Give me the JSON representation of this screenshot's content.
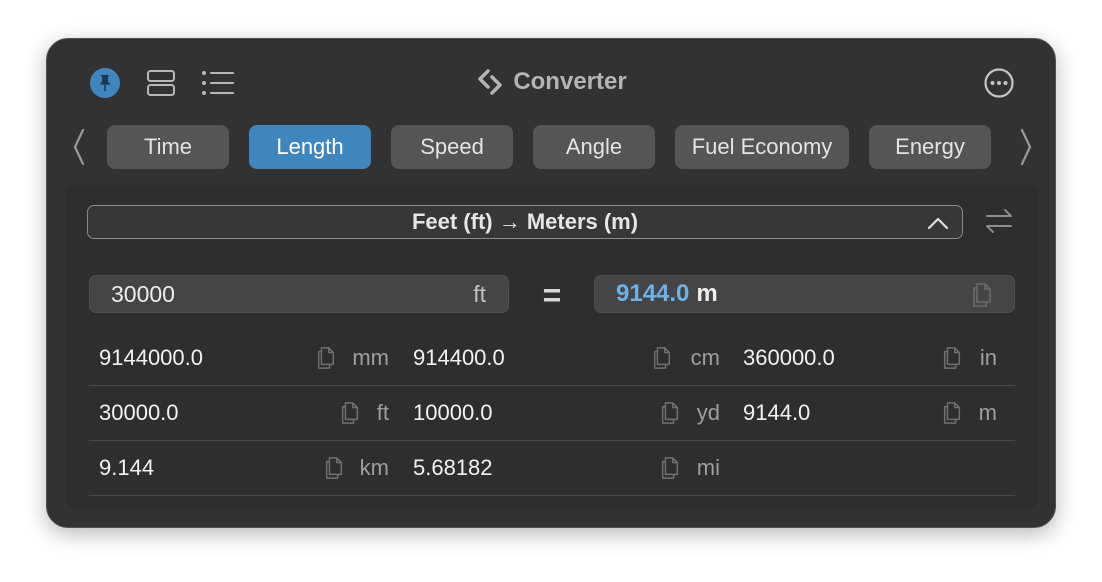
{
  "window": {
    "title": "Converter"
  },
  "icons": {
    "pin": "pin-icon",
    "layout": "layout-stack-icon",
    "list": "list-icon",
    "logo": "converter-logo-icon",
    "more": "more-options-icon"
  },
  "tabs": [
    {
      "label": "Time",
      "active": false
    },
    {
      "label": "Length",
      "active": true
    },
    {
      "label": "Speed",
      "active": false
    },
    {
      "label": "Angle",
      "active": false
    },
    {
      "label": "Fuel Economy",
      "active": false
    },
    {
      "label": "Energy",
      "active": false
    }
  ],
  "conversion": {
    "label": "Feet (ft) → Meters (m)"
  },
  "input": {
    "value": "30000",
    "unit": "ft"
  },
  "equals": "=",
  "result": {
    "value": "9144.0",
    "unit": "m"
  },
  "rows": [
    [
      {
        "value": "9144000.0",
        "unit": "mm"
      },
      {
        "value": "914400.0",
        "unit": "cm"
      },
      {
        "value": "360000.0",
        "unit": "in"
      }
    ],
    [
      {
        "value": "30000.0",
        "unit": "ft"
      },
      {
        "value": "10000.0",
        "unit": "yd"
      },
      {
        "value": "9144.0",
        "unit": "m"
      }
    ],
    [
      {
        "value": "9.144",
        "unit": "km"
      },
      {
        "value": "5.68182",
        "unit": "mi"
      }
    ]
  ],
  "colors": {
    "window_bg": "#323232",
    "accent": "#3f86be",
    "result_value": "#6cb2e6",
    "tab_bg": "#555555"
  }
}
